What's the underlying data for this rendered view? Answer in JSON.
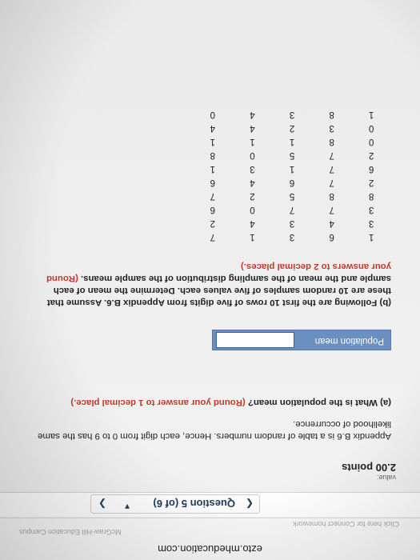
{
  "browser": {
    "url": "ezto.mheducation.com",
    "faint_top": "McGraw-Hill Education Campus",
    "faint_left": "Click here for Connect homework"
  },
  "question_nav": {
    "title": "Question 5 (of 6)",
    "prev_icon": "chevron-left-icon",
    "next_icon": "chevron-right-icon",
    "dropdown_icon": "caret-down-icon"
  },
  "value_block": {
    "label": "value:",
    "points": "2.00 points"
  },
  "intro": "Appendix B.6 is a table of random numbers. Hence, each digit from 0 to 9 has the same likelihood of occurrence.",
  "part_a": {
    "prefix": "(a) What is the population mean?",
    "instruction": "(Round your answer to 1 decimal place.)"
  },
  "population_mean": {
    "label": "Population mean",
    "value": ""
  },
  "part_b": {
    "prefix": "(b) Following are the first 10 rows of five digits from Appendix B.6. Assume that these are 10 random samples of five values each. Determine the mean of each sample and the mean of the sampling distribution of the sample means.",
    "instruction": "(Round your answers to 2 decimal places.)"
  },
  "table": {
    "rows": [
      [
        "1",
        "6",
        "3",
        "1",
        "7"
      ],
      [
        "3",
        "4",
        "3",
        "4",
        "2"
      ],
      [
        "3",
        "7",
        "7",
        "0",
        "6"
      ],
      [
        "8",
        "8",
        "5",
        "2",
        "7"
      ],
      [
        "2",
        "7",
        "6",
        "4",
        "6"
      ],
      [
        "6",
        "7",
        "1",
        "3",
        "1"
      ],
      [
        "2",
        "7",
        "5",
        "0",
        "8"
      ],
      [
        "0",
        "8",
        "1",
        "1",
        "1"
      ],
      [
        "0",
        "3",
        "2",
        "4",
        "4"
      ],
      [
        "1",
        "8",
        "3",
        "4",
        "0"
      ]
    ]
  }
}
